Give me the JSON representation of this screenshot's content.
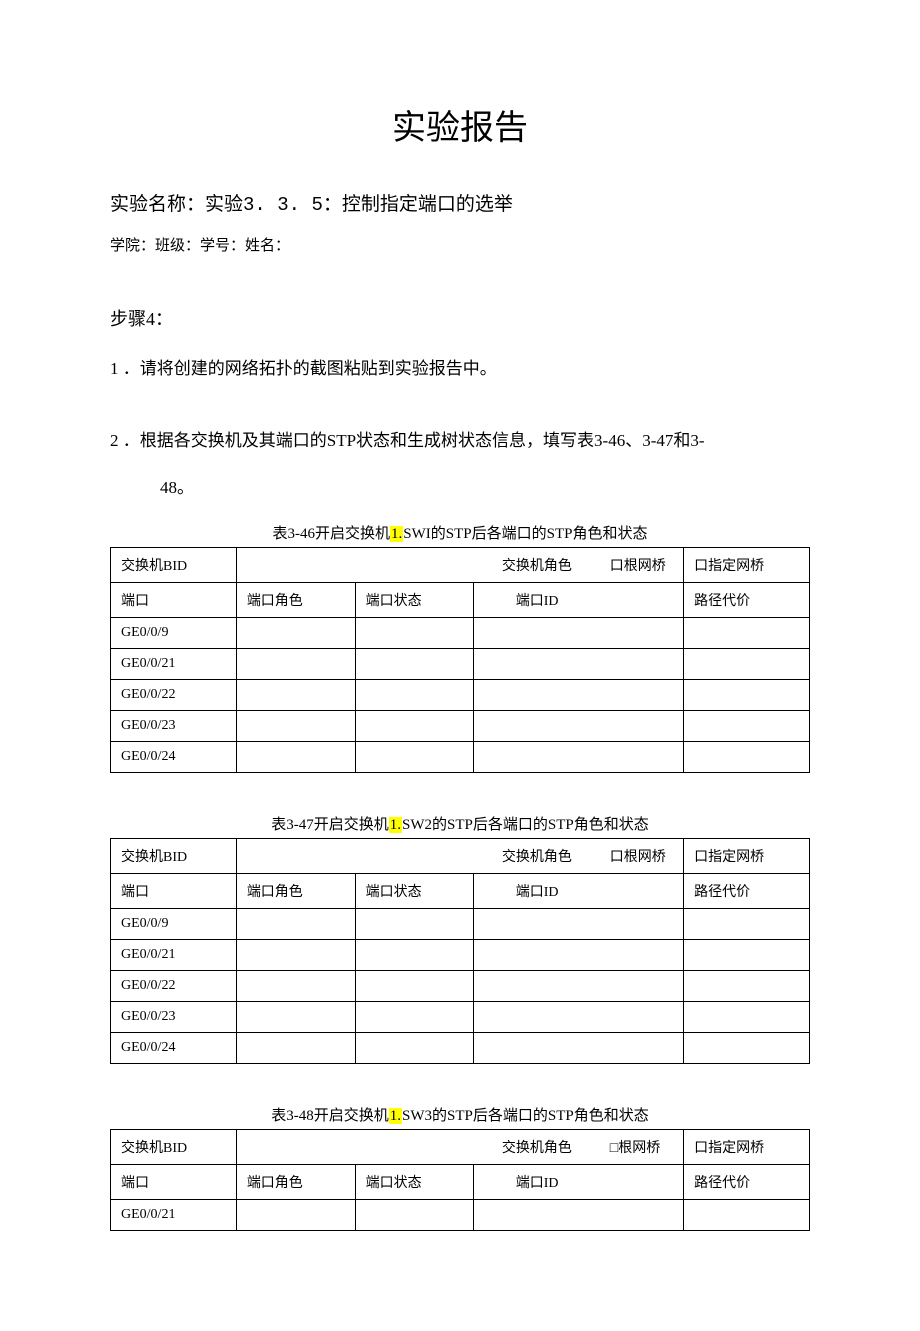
{
  "title": "实验报告",
  "exp_label": "实验名称：",
  "exp_prefix": "实验",
  "exp_num": "3. 3. 5：",
  "exp_title": "控制指定端口的选举",
  "meta": "学院：班级：学号：姓名：",
  "step_head": "步骤4：",
  "item1_num": "1",
  "item1_txt": " ．请将创建的网络拓扑的截图粘贴到实验报告中。",
  "item2_num": "2",
  "item2_txt": " ．根据各交换机及其端口的STP状态和生成树状态信息，填写表3-46、3-47和3-",
  "item2_cont": "48。",
  "cap1_a": "表3-46开启交换机",
  "cap1_hl": "1.",
  "cap1_b": "SWI的STP后各端口的STP角色和状态",
  "cap2_a": "表3-47开启交换机",
  "cap2_hl": "1.",
  "cap2_b": "SW2的STP后各端口的STP角色和状态",
  "cap3_a": "表3-48开启交换机",
  "cap3_hl": "1.",
  "cap3_b": "SW3的STP后各端口的STP角色和状态",
  "hdr": {
    "bid": "交换机BID",
    "role_label": "交换机角色",
    "root": "口根网桥",
    "desig": "口指定网桥",
    "root_box": "□根网桥",
    "port": "端口",
    "prole": "端口角色",
    "pstate": "端口状态",
    "pid": "端口ID",
    "cost": "路径代价"
  },
  "t1_ports": {
    "r1": "GE0/0/9",
    "r2": "GE0/0/21",
    "r3": "GE0/0/22",
    "r4": "GE0/0/23",
    "r5": "GE0/0/24"
  },
  "t2_ports": {
    "r1": "GE0/0/9",
    "r2": "GE0/0/21",
    "r3": "GE0/0/22",
    "r4": "GE0/0/23",
    "r5": "GE0/0/24"
  },
  "t3_ports": {
    "r1": "GE0/0/21"
  }
}
